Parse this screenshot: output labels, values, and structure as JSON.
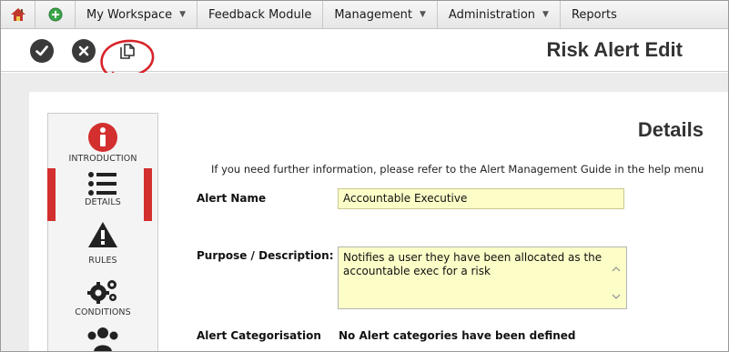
{
  "nav": {
    "items": [
      {
        "label": "My Workspace",
        "has_dropdown": true
      },
      {
        "label": "Feedback Module",
        "has_dropdown": false
      },
      {
        "label": "Management",
        "has_dropdown": true
      },
      {
        "label": "Administration",
        "has_dropdown": true
      },
      {
        "label": "Reports",
        "has_dropdown": false
      }
    ],
    "dropdown_glyph": "▼"
  },
  "toolbar": {
    "save_icon": "check-circle-icon",
    "cancel_icon": "close-circle-icon",
    "copy_icon": "copy-icon",
    "page_title": "Risk Alert Edit"
  },
  "steps": [
    {
      "label": "INTRODUCTION",
      "icon": "info-icon",
      "active": false
    },
    {
      "label": "DETAILS",
      "icon": "list-icon",
      "active": true
    },
    {
      "label": "RULES",
      "icon": "warning-icon",
      "active": false
    },
    {
      "label": "CONDITIONS",
      "icon": "gears-icon",
      "active": false
    },
    {
      "label": "",
      "icon": "users-icon",
      "active": false
    }
  ],
  "form": {
    "section_title": "Details",
    "info_text": "If you need further information, please refer to the Alert Management Guide in the help menu",
    "alert_name_label": "Alert Name",
    "alert_name_value": "Accountable Executive",
    "purpose_label": "Purpose / Description:",
    "purpose_value": "Notifies a user they have been allocated as the accountable exec for a risk",
    "categorisation_label": "Alert Categorisation",
    "categorisation_value": "No Alert categories have been defined"
  },
  "colors": {
    "accent_red": "#d32f2f",
    "input_bg": "#fdfdc8",
    "dark_icon": "#3a3a3a"
  }
}
